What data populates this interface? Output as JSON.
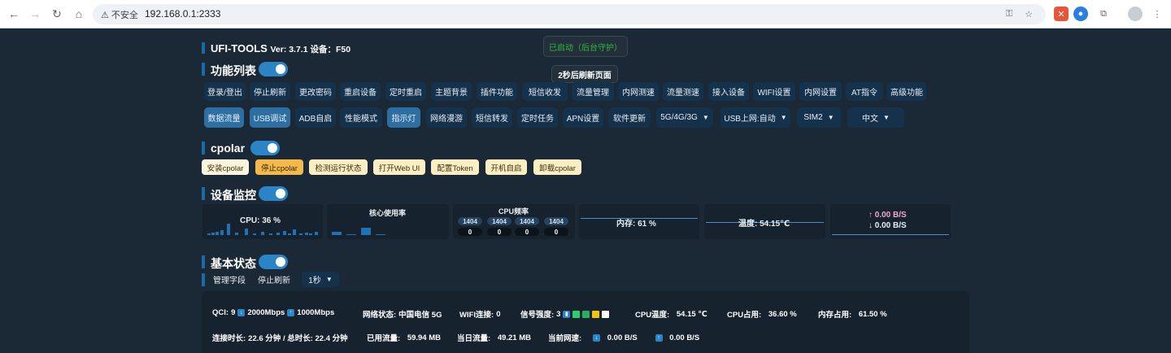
{
  "browser": {
    "security_label": "不安全",
    "url": "192.168.0.1:2333"
  },
  "header": {
    "app_title": "UFI-TOOLS",
    "version_text": "Ver: 3.7.1  设备：F50"
  },
  "toasts": {
    "guard": "已启动（后台守护）",
    "refresh": "2秒后刷新页面"
  },
  "features": {
    "title": "功能列表",
    "row1": [
      "登录/登出",
      "停止刷新",
      "更改密码",
      "重启设备",
      "定时重启",
      "主题背景",
      "插件功能",
      "短信收发",
      "流量管理",
      "内网测速",
      "流量测速",
      "接入设备",
      "WIFI设置",
      "内网设置",
      "AT指令",
      "高级功能"
    ],
    "row2": [
      "数据流量",
      "USB调试",
      "ADB自启",
      "性能模式",
      "指示灯",
      "网络漫游",
      "短信转发",
      "定时任务",
      "APN设置",
      "软件更新"
    ],
    "selects": [
      "5G/4G/3G",
      "USB上网:自动",
      "SIM2",
      "中文"
    ]
  },
  "cpolar": {
    "title": "cpolar",
    "buttons": [
      "安装cpolar",
      "停止cpolar",
      "检测运行状态",
      "打开Web UI",
      "配置Token",
      "开机自启",
      "卸载cpolar"
    ]
  },
  "monitor": {
    "title": "设备监控",
    "cpu": "CPU: 36 %",
    "core_usage": "核心使用率",
    "cpu_freq": "CPU频率",
    "freq_values": [
      "1404",
      "1404",
      "1404",
      "1404"
    ],
    "freq_usage": [
      "0",
      "0",
      "0",
      "0"
    ],
    "memory": "内存: 61 %",
    "temp": "温度: 54.15℃",
    "up_speed": "↑  0.00 B/S",
    "down_speed": "↓  0.00 B/S",
    "cpu_usage_level": 0.36,
    "memory_usage_level": 0.61
  },
  "basic": {
    "title": "基本状态",
    "manage_fields": "管理字段",
    "stop_refresh": "停止刷新",
    "interval": "1秒",
    "qci_label": "QCI:",
    "qci": "9",
    "dl_rate": "2000Mbps",
    "ul_rate": "1000Mbps",
    "network_status_label": "网络状态:",
    "network_status": "中国电信 5G",
    "wifi_label": "WIFI连接:",
    "wifi": "0",
    "signal_label": "信号强度:",
    "signal": "3",
    "cpu_temp_label": "CPU温度:",
    "cpu_temp": "54.15 ℃",
    "cpu_use_label": "CPU占用:",
    "cpu_use": "36.60 %",
    "mem_use_label": "内存占用:",
    "mem_use": "61.50 %",
    "conn_label": "连接时长:",
    "conn": "22.6 分钟 / 总时长: 22.4 分钟",
    "used_label": "已用流量:",
    "used": "59.94 MB",
    "today_label": "当日流量:",
    "today": "49.21 MB",
    "speed_label": "当前网速:",
    "speed_down": "0.00 B/S",
    "speed_up": "0.00 B/S",
    "signal_colors": [
      "#2ecc71",
      "#27ae60",
      "#f1c40f",
      "#ffffff"
    ]
  }
}
